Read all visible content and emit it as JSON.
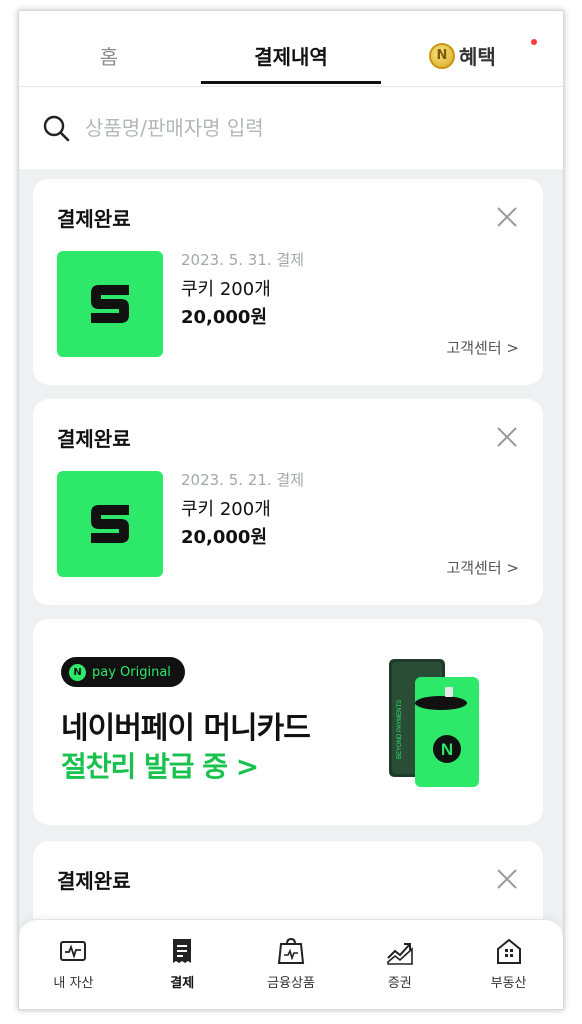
{
  "tabs": {
    "home": "홈",
    "payments": "결제내역",
    "benefits": "혜택",
    "coin_letter": "N"
  },
  "search": {
    "placeholder": "상품명/판매자명 입력"
  },
  "payments": [
    {
      "status": "결제완료",
      "date": "2023. 5. 31. 결제",
      "item": "쿠키 200개",
      "price": "20,000원",
      "support": "고객센터 >",
      "logo_letter": "S"
    },
    {
      "status": "결제완료",
      "date": "2023. 5. 21. 결제",
      "item": "쿠키 200개",
      "price": "20,000원",
      "support": "고객센터 >",
      "logo_letter": "S"
    },
    {
      "status": "결제완료"
    }
  ],
  "banner": {
    "badge_n": "N",
    "badge_text": "pay Original",
    "title": "네이버페이 머니카드",
    "subtitle": "절찬리 발급 중 >",
    "card_vertical_text": "BEYOND PAYMENTS",
    "card_letter": "N"
  },
  "bottom_nav": [
    {
      "label": "내 자산",
      "icon": "wallet-chart-icon"
    },
    {
      "label": "결제",
      "icon": "receipt-icon"
    },
    {
      "label": "금융상품",
      "icon": "bag-chart-icon"
    },
    {
      "label": "증권",
      "icon": "stock-up-icon"
    },
    {
      "label": "부동산",
      "icon": "house-icon"
    }
  ],
  "colors": {
    "brand_green": "#2ee86a",
    "banner_green": "#19c24d",
    "notification": "#ff3b3b"
  }
}
